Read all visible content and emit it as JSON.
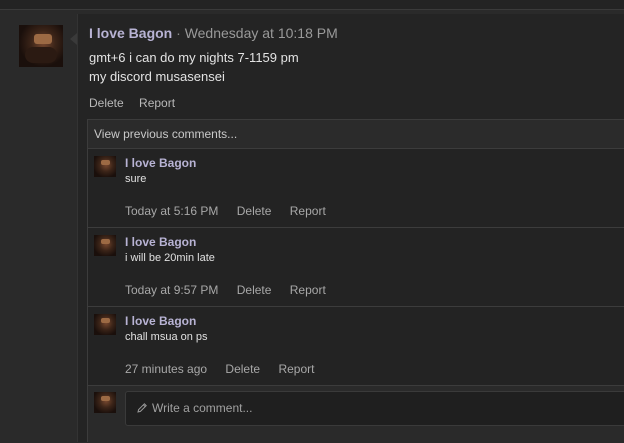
{
  "post": {
    "author": "I love Bagon",
    "separator": "·",
    "time": "Wednesday at 10:18 PM",
    "lines": [
      "gmt+6 i can do my nights 7-1159 pm",
      "my discord musasensei"
    ],
    "actions": {
      "delete": "Delete",
      "report": "Report"
    }
  },
  "comments": {
    "view_previous": "View previous comments...",
    "items": [
      {
        "author": "I love Bagon",
        "text": "sure",
        "time": "Today at 5:16 PM",
        "delete": "Delete",
        "report": "Report"
      },
      {
        "author": "I love Bagon",
        "text": "i will be 20min late",
        "time": "Today at 9:57 PM",
        "delete": "Delete",
        "report": "Report"
      },
      {
        "author": "I love Bagon",
        "text": "chall msua on ps",
        "time": "27 minutes ago",
        "delete": "Delete",
        "report": "Report"
      }
    ],
    "write_placeholder": "Write a comment..."
  },
  "icons": {
    "avatar": "avatar",
    "pencil": "pencil-icon"
  }
}
